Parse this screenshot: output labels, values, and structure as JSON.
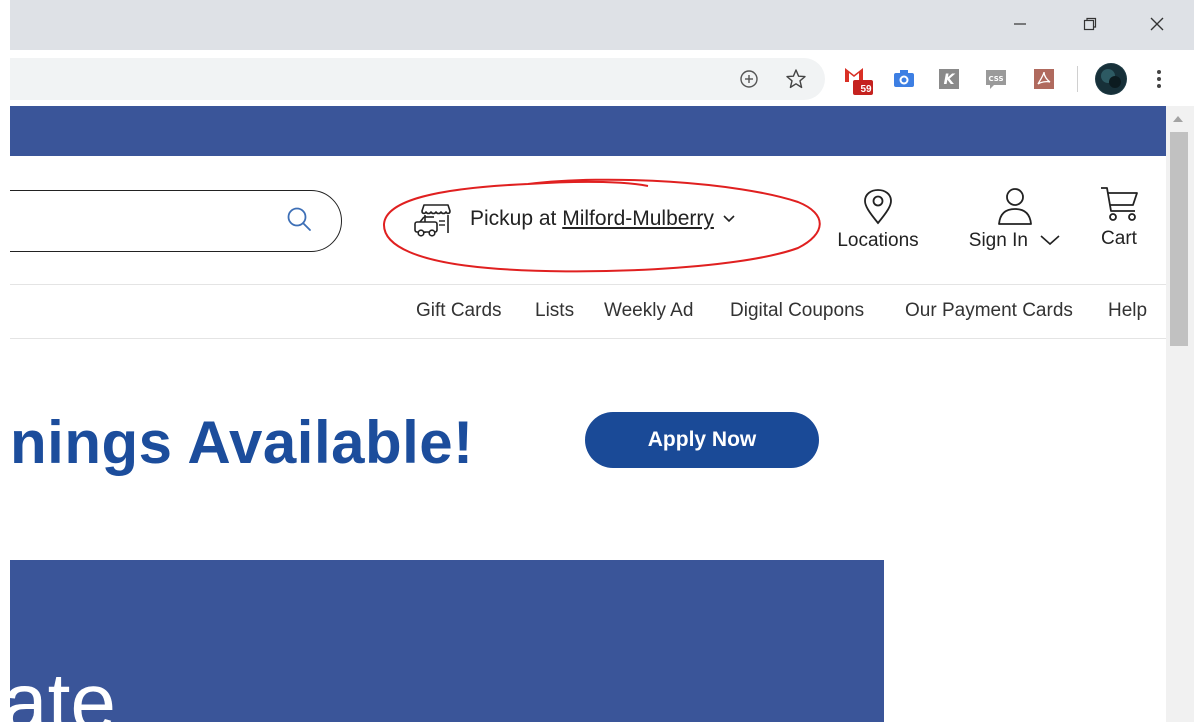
{
  "browser": {
    "window_controls": [
      "minimize",
      "restore",
      "close"
    ],
    "extensions": [
      {
        "icon": "gmail-icon",
        "badge": "59"
      },
      {
        "icon": "camera-icon"
      },
      {
        "icon": "k-extension-icon"
      },
      {
        "icon": "css-icon"
      },
      {
        "icon": "pdf-icon"
      }
    ]
  },
  "header": {
    "pickup": {
      "prefix": "Pickup at",
      "store": "Milford-Mulberry"
    },
    "locations_label": "Locations",
    "signin_label": "Sign In",
    "cart_label": "Cart"
  },
  "subnav": {
    "items": [
      "Gift Cards",
      "Lists",
      "Weekly Ad",
      "Digital Coupons",
      "Our Payment Cards",
      "Help"
    ]
  },
  "hero": {
    "headline": "nings Available!",
    "apply_label": "Apply Now",
    "banner_text": "ate"
  },
  "colors": {
    "brand_blue": "#3a5599",
    "headline_blue": "#1c4d9c",
    "button_blue": "#1a4a97",
    "annotation_red": "#e02020"
  }
}
